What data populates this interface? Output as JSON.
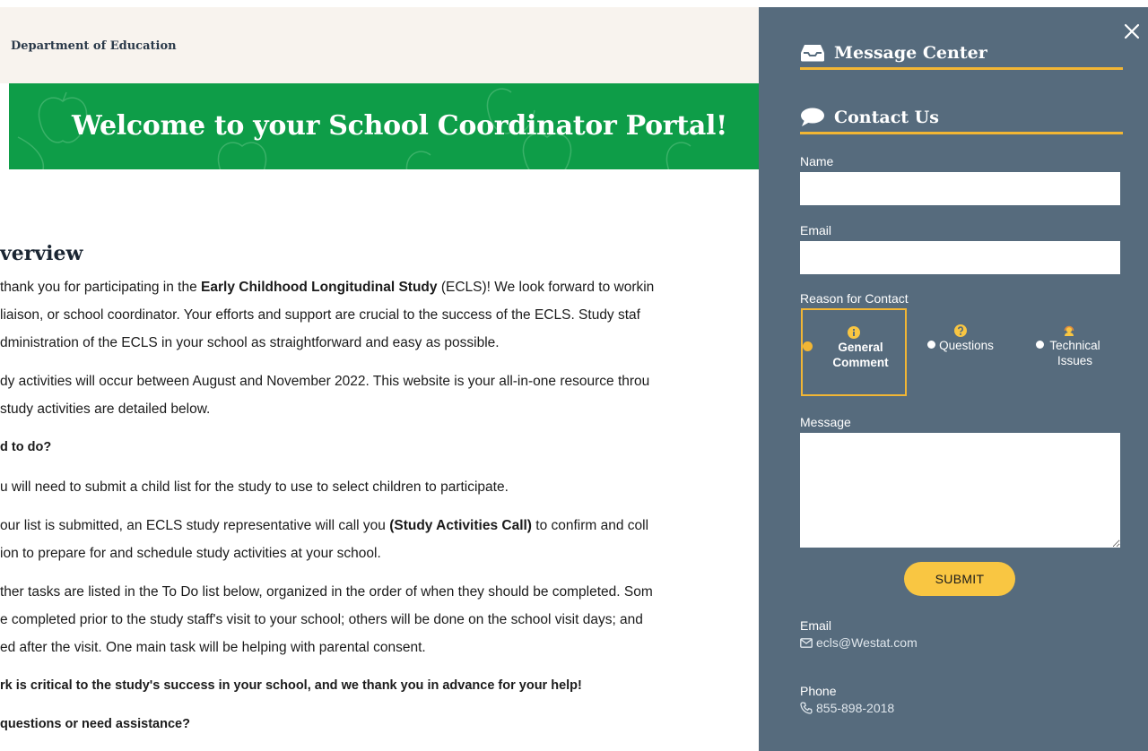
{
  "header": {
    "department": "Department of Education"
  },
  "banner": {
    "title": "Welcome to your School Coordinator Portal!"
  },
  "overview": {
    "heading": "verview",
    "p1_l1_pre": "thank you for participating in the ",
    "p1_l1_bold": "Early Childhood Longitudinal Study",
    "p1_l1_post": " (ECLS)! We look forward to workin",
    "p1_l2": "liaison, or school coordinator. Your efforts and support are crucial to the success of the ECLS. Study staf",
    "p1_l3": "dministration of the ECLS in your school as straightforward and easy as possible.",
    "p2_l1": "dy activities will occur between August and November 2022. This website is your all-in-one resource throu",
    "p2_l2": "study activities are detailed below.",
    "q1": "d to do?",
    "p3": "u will need to submit a child list for the study to use to select children to participate.",
    "p4_l1_pre": "our list is submitted, an ECLS study representative will call you ",
    "p4_l1_bold": "(Study Activities Call)",
    "p4_l1_post": " to confirm and coll",
    "p4_l2": "ion to prepare for and schedule study activities at your school.",
    "p5_l1": "ther tasks are listed in the To Do list below, organized in the order of when they should be completed. Som",
    "p5_l2": "e completed prior to the study staff's visit to your school; others will be done on the school visit days; and",
    "p5_l3": "ed after the visit. One main task will be helping with parental consent.",
    "bold_line": "rk is critical to the study's success in your school, and we thank you in advance for your help!",
    "q2": "questions or need assistance?"
  },
  "panel": {
    "message_center": "Message Center",
    "contact_us": "Contact Us",
    "name_label": "Name",
    "name_value": "",
    "email_label": "Email",
    "email_value": "",
    "reason_label": "Reason for Contact",
    "reasons": [
      {
        "label": "General Comment",
        "selected": true,
        "icon": "info-icon"
      },
      {
        "label": "Questions",
        "selected": false,
        "icon": "question-icon"
      },
      {
        "label": "Technical Issues",
        "selected": false,
        "icon": "headset-icon"
      }
    ],
    "message_label": "Message",
    "message_value": "",
    "submit_label": "SUBMIT",
    "contact_email_label": "Email",
    "contact_email": "ecls@Westat.com",
    "contact_phone_label": "Phone",
    "contact_phone": "855-898-2018"
  },
  "colors": {
    "panel_bg": "#566b7d",
    "accent": "#f2b634",
    "button": "#f9c642",
    "banner": "#0e9d48"
  }
}
